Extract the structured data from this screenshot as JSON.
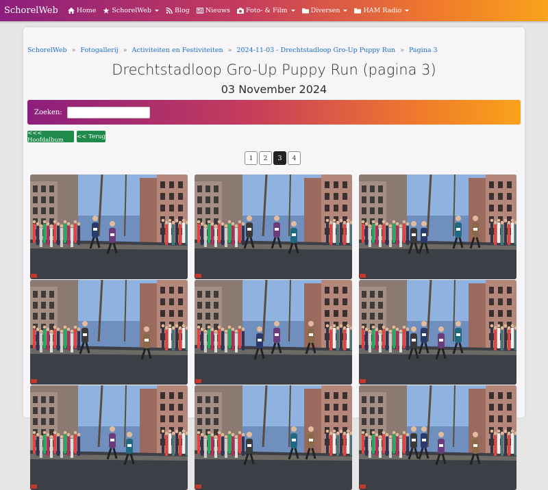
{
  "nav": {
    "brand": "SchorelWeb",
    "items": [
      {
        "label": "Home",
        "icon": "home-icon",
        "dropdown": false
      },
      {
        "label": "SchorelWeb",
        "icon": "star-icon",
        "dropdown": true
      },
      {
        "label": "Blog",
        "icon": "rss-icon",
        "dropdown": false
      },
      {
        "label": "Nieuws",
        "icon": "newspaper-icon",
        "dropdown": false
      },
      {
        "label": "Foto- & Film",
        "icon": "camera-icon",
        "dropdown": true
      },
      {
        "label": "Diversen",
        "icon": "folder-icon",
        "dropdown": true
      },
      {
        "label": "HAM Radio",
        "icon": "folder-icon",
        "dropdown": true
      }
    ]
  },
  "breadcrumb": [
    "SchorelWeb",
    "Fotogallerij",
    "Activiteiten en Festiviteiten",
    "2024-11-03 - Drechtstadloop Gro-Up Puppy Run",
    "Pagina 3"
  ],
  "page": {
    "title": "Drechtstadloop Gro-Up Puppy Run (pagina 3)",
    "date": "03 November 2024"
  },
  "search": {
    "label": "Zoeken:",
    "value": ""
  },
  "buttons": {
    "main_album": "<<< Hoofdalbum",
    "back": "<< Terug"
  },
  "pagination": {
    "pages": [
      "1",
      "2",
      "3",
      "4"
    ],
    "current": "3"
  },
  "colors": {
    "brand_gradient_start": "#8c1e7e",
    "brand_gradient_end": "#f9a21a",
    "button_green": "#1f8a4c",
    "link_blue": "#1a6fc9"
  }
}
